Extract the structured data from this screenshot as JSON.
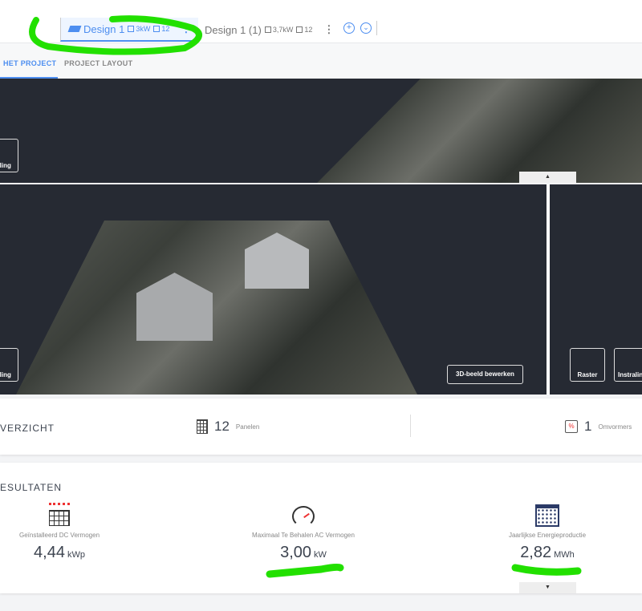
{
  "tabs": [
    {
      "label": "Design 1",
      "power": "3kW",
      "panels": "12",
      "active": true
    },
    {
      "label": "Design 1 (1)",
      "power": "3,7kW",
      "panels": "12",
      "active": false
    }
  ],
  "subnav": [
    "HET PROJECT",
    "PROJECT LAYOUT"
  ],
  "map": {
    "edit_label": "3D-beeld bewerken",
    "raster_label": "Raster",
    "instraling_label": "Instraling",
    "instraling_cut": "raling"
  },
  "overview": {
    "title": "VERZICHT",
    "panels_count": "12",
    "panels_label": "Panelen",
    "inverters_count": "1",
    "inverters_label": "Omvormers"
  },
  "results": {
    "title": "ESULTATEN",
    "items": [
      {
        "label": "Geïnstalleerd DC Vermogen",
        "value": "4,44",
        "unit": "kWp"
      },
      {
        "label": "Maximaal Te Behalen AC Vermogen",
        "value": "3,00",
        "unit": "kW"
      },
      {
        "label": "Jaarlijkse Energieproductie",
        "value": "2,82",
        "unit": "MWh"
      }
    ]
  },
  "colors": {
    "accent": "#4d8ef0",
    "annotation": "#22e000"
  }
}
